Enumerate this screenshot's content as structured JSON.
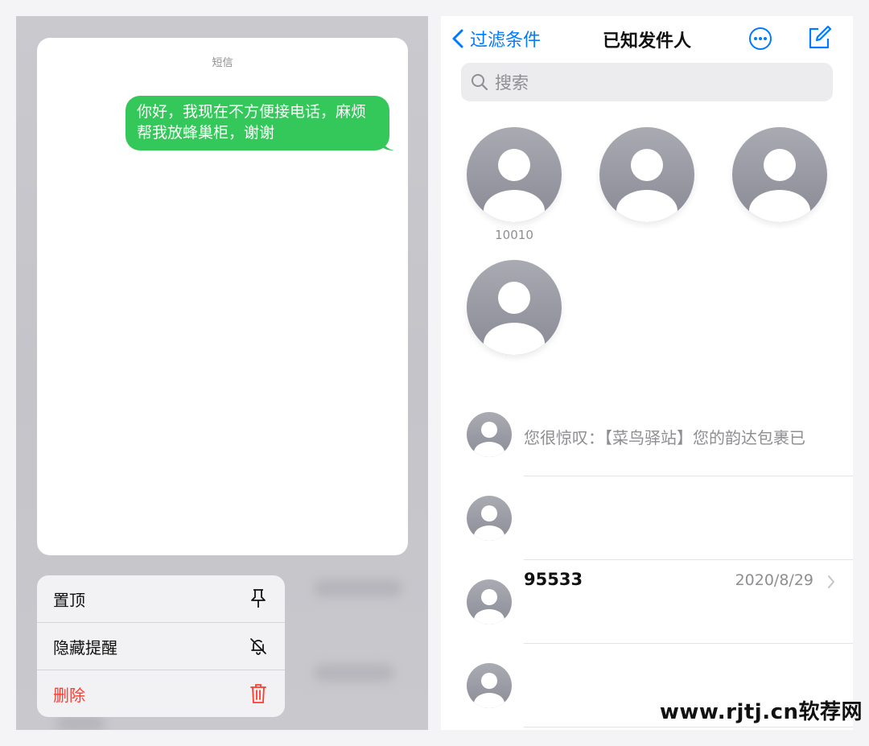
{
  "left": {
    "card_title": "短信",
    "message": "你好，我现在不方便接电话，麻烦帮我放蜂巢柜，谢谢",
    "menu": [
      {
        "label": "置顶",
        "icon": "pin-icon",
        "color": "#111111"
      },
      {
        "label": "隐藏提醒",
        "icon": "bell-slash-icon",
        "color": "#111111"
      },
      {
        "label": "删除",
        "icon": "trash-icon",
        "color": "#ff3b30"
      }
    ],
    "bubble_color": "#34c759"
  },
  "right": {
    "nav": {
      "back_label": "过滤条件",
      "title": "已知发件人",
      "more_icon": "ellipsis-circle-icon",
      "compose_icon": "compose-icon"
    },
    "search": {
      "placeholder": "搜索",
      "icon": "search-icon"
    },
    "pinned": [
      {
        "label": "10010"
      },
      {
        "label": ""
      },
      {
        "label": ""
      },
      {
        "label": ""
      }
    ],
    "conversations": [
      {
        "sender": "",
        "preview": "您很惊叹：【菜鸟驿站】您的韵达包裹已",
        "date": ""
      },
      {
        "sender": "",
        "preview": "",
        "date": ""
      },
      {
        "sender": "95533",
        "preview": "",
        "date": "2020/8/29"
      },
      {
        "sender": "",
        "preview": "",
        "date": ""
      }
    ],
    "accent_color": "#007aff"
  },
  "watermark": "www.rjtj.cn软荐网"
}
